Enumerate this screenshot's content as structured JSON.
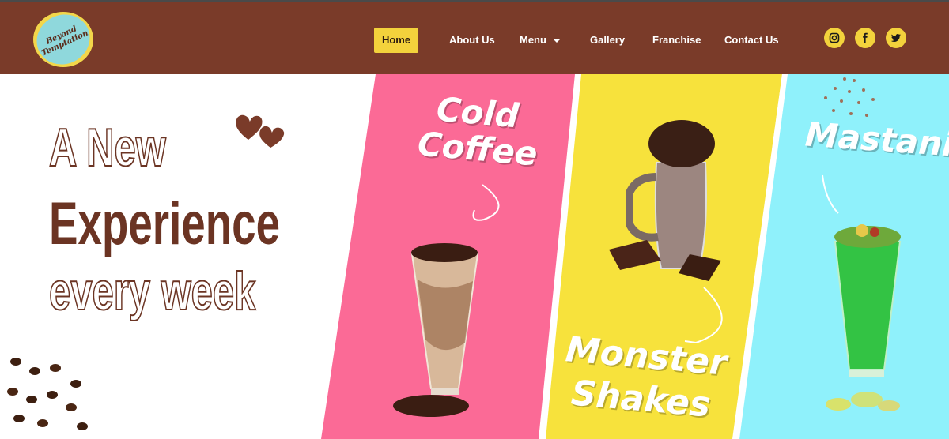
{
  "logo": {
    "line1": "Beyond",
    "line2": "Temptation"
  },
  "nav": {
    "items": [
      {
        "label": "Home",
        "active": true
      },
      {
        "label": "About Us"
      },
      {
        "label": "Menu",
        "has_dropdown": true
      },
      {
        "label": "Gallery"
      },
      {
        "label": "Franchise"
      },
      {
        "label": "Contact Us"
      }
    ]
  },
  "social": [
    "instagram-icon",
    "facebook-icon",
    "twitter-icon"
  ],
  "hero": {
    "line1": "A New",
    "line2": "Experience",
    "line3": "every week"
  },
  "panels": [
    {
      "name": "cold-coffee",
      "line1": "Cold",
      "line2": "Coffee",
      "color": "#fb6a96"
    },
    {
      "name": "monster-shakes",
      "line1": "Monster",
      "line2": "Shakes",
      "color": "#f7e23c"
    },
    {
      "name": "mastani",
      "line1": "Mastani",
      "color": "#8ff1fb"
    }
  ],
  "colors": {
    "header": "#7a3b29",
    "accent": "#f3d23c",
    "brown": "#6b3423"
  }
}
